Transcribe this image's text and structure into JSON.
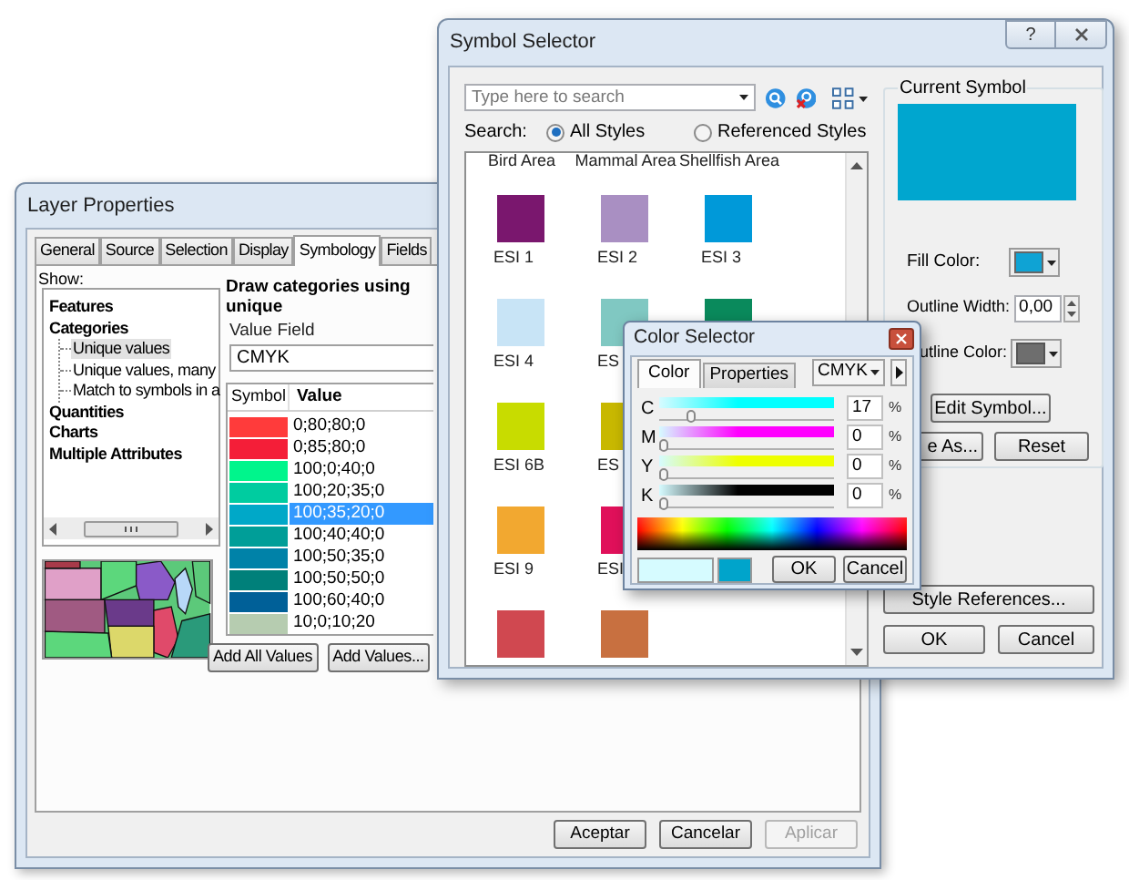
{
  "layer_properties": {
    "title": "Layer Properties",
    "tabs": [
      {
        "label": "General",
        "selected": false
      },
      {
        "label": "Source",
        "selected": false
      },
      {
        "label": "Selection",
        "selected": false
      },
      {
        "label": "Display",
        "selected": false
      },
      {
        "label": "Symbology",
        "selected": true
      },
      {
        "label": "Fields",
        "selected": false
      }
    ],
    "show_label": "Show:",
    "tree": [
      {
        "label": "Features",
        "selected": false
      },
      {
        "label": "Categories",
        "selected": false,
        "children": [
          {
            "label": "Unique values",
            "selected": true
          },
          {
            "label": "Unique values, many",
            "selected": false
          },
          {
            "label": "Match to symbols in a",
            "selected": false
          }
        ]
      },
      {
        "label": "Quantities",
        "selected": false
      },
      {
        "label": "Charts",
        "selected": false
      },
      {
        "label": "Multiple Attributes",
        "selected": false
      }
    ],
    "heading": "Draw categories using unique",
    "value_field": {
      "label": "Value Field",
      "value": "CMYK"
    },
    "table": {
      "columns": [
        "Symbol",
        "Value"
      ],
      "rows": [
        {
          "color": "#ff3b3b",
          "value": "0;80;80;0",
          "selected": false
        },
        {
          "color": "#f41e38",
          "value": "0;85;80;0",
          "selected": false
        },
        {
          "color": "#00f58c",
          "value": "100;0;40;0",
          "selected": false
        },
        {
          "color": "#00cca0",
          "value": "100;20;35;0",
          "selected": false
        },
        {
          "color": "#00a8c8",
          "value": "100;35;20;0",
          "selected": true
        },
        {
          "color": "#009e98",
          "value": "100;40;40;0",
          "selected": false
        },
        {
          "color": "#0082a8",
          "value": "100;50;35;0",
          "selected": false
        },
        {
          "color": "#00807a",
          "value": "100;50;50;0",
          "selected": false
        },
        {
          "color": "#006098",
          "value": "100;60;40;0",
          "selected": false
        },
        {
          "color": "#b6ccb0",
          "value": "10;0;10;20",
          "selected": false
        }
      ]
    },
    "buttons": [
      "Add All Values",
      "Add Values..."
    ],
    "footer_buttons": [
      {
        "label": "Aceptar",
        "disabled": false
      },
      {
        "label": "Cancelar",
        "disabled": false
      },
      {
        "label": "Aplicar",
        "disabled": true
      }
    ]
  },
  "symbol_selector": {
    "title": "Symbol Selector",
    "help_button": "?",
    "search": {
      "placeholder": "Type here to search"
    },
    "search_label": "Search:",
    "scopes": [
      {
        "label": "All Styles",
        "selected": true
      },
      {
        "label": "Referenced Styles",
        "selected": false
      }
    ],
    "columns": [
      "Bird Area",
      "Mammal Area",
      "Shellfish Area"
    ],
    "symbol_rows": [
      [
        {
          "color": "#7a176e",
          "label": "ESI 1"
        },
        {
          "color": "#a98fc2",
          "label": "ESI 2"
        },
        {
          "color": "#0099d9",
          "label": "ESI 3"
        }
      ],
      [
        {
          "color": "#c8e4f6",
          "label": "ESI 4"
        },
        {
          "color": "#80c8c2",
          "label": "ES"
        },
        {
          "color": "#0a8a5c"
        }
      ],
      [
        {
          "color": "#c8dc00",
          "label": "ESI 6B"
        },
        {
          "color": "#c8b800",
          "label": "ES"
        }
      ],
      [
        {
          "color": "#f2a830",
          "label": "ESI 9"
        },
        {
          "color": "#e0105a",
          "label": "ESI"
        }
      ],
      [
        {
          "color": "#d04850"
        },
        {
          "color": "#c87040"
        }
      ]
    ],
    "current_symbol": {
      "title": "Current Symbol",
      "color": "#00a6cf"
    },
    "fill_color": {
      "label": "Fill Color:",
      "color": "#0fa3d4"
    },
    "outline_width": {
      "label": "Outline Width:",
      "value": "0,00"
    },
    "outline_color": {
      "label": "utline Color:",
      "color": "#6e6e6e"
    },
    "buttons": {
      "edit": "Edit Symbol...",
      "save_as": "e As...",
      "reset": "Reset",
      "style_references": "Style References...",
      "ok": "OK",
      "cancel": "Cancel"
    }
  },
  "color_selector": {
    "title": "Color Selector",
    "tabs": [
      {
        "label": "Color",
        "selected": true
      },
      {
        "label": "Properties",
        "selected": false
      }
    ],
    "model": "CMYK",
    "channels": [
      {
        "name": "C",
        "value": "17",
        "unit": "%",
        "level": 0.17,
        "color": "#00ffff"
      },
      {
        "name": "M",
        "value": "0",
        "unit": "%",
        "level": 0,
        "color": "#ff00ff"
      },
      {
        "name": "Y",
        "value": "0",
        "unit": "%",
        "level": 0,
        "color": "#eeff00"
      },
      {
        "name": "K",
        "value": "0",
        "unit": "%",
        "level": 0,
        "color": "#000000"
      }
    ],
    "swatches": [
      {
        "color": "#d6fbff"
      },
      {
        "color": "#00a4cb"
      }
    ],
    "buttons": [
      "OK",
      "Cancel"
    ]
  }
}
